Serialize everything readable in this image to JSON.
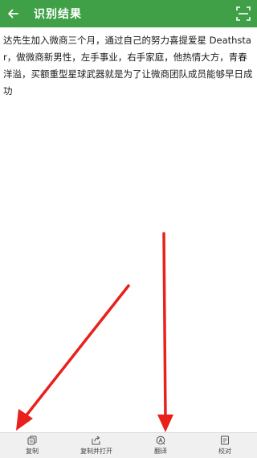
{
  "app_bar": {
    "title": "识别结果",
    "back_icon": "arrow-left-icon",
    "scan_icon": "scan-frame-icon",
    "color": "#3fa048"
  },
  "content": {
    "text": "达先生加入微商三个月，通过自己的努力喜提爱星 Deathstar，做微商新男性，左手事业，右手家庭，他热情大方，青春洋溢，买额重型星球武器就是为了让微商团队成员能够早日成功"
  },
  "bottom_bar": {
    "items": [
      {
        "label": "复制",
        "icon": "copy-icon"
      },
      {
        "label": "复制并打开",
        "icon": "share-open-icon"
      },
      {
        "label": "翻译",
        "icon": "translate-icon"
      },
      {
        "label": "校对",
        "icon": "proofread-icon"
      }
    ]
  },
  "annotation_color": "#e8211b"
}
